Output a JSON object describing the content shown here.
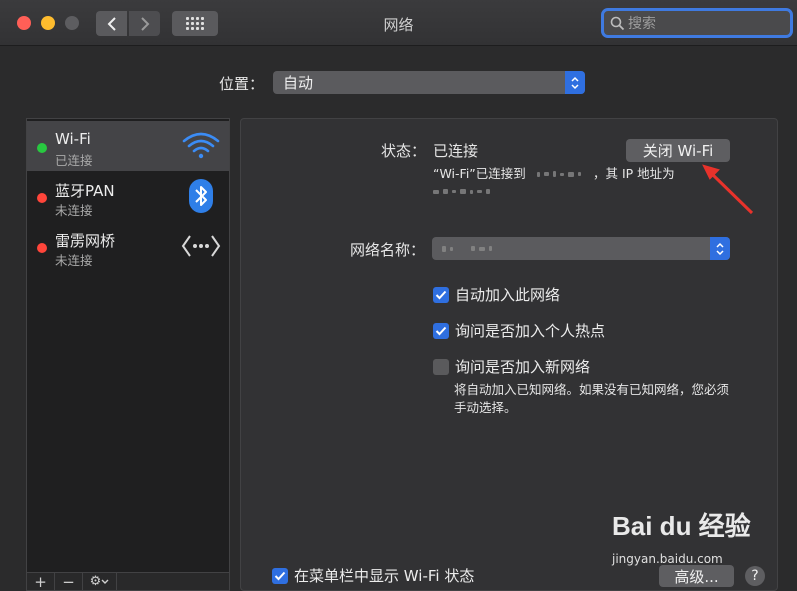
{
  "window": {
    "title": "网络",
    "search_placeholder": "搜索"
  },
  "location": {
    "label": "位置：",
    "value": "自动"
  },
  "sidebar": {
    "services": [
      {
        "name": "Wi-Fi",
        "status": "已连接",
        "dot_color": "#28c840",
        "icon": "wifi-icon"
      },
      {
        "name": "蓝牙PAN",
        "status": "未连接",
        "dot_color": "#ff453a",
        "icon": "bluetooth-icon"
      },
      {
        "name": "雷雳网桥",
        "status": "未连接",
        "dot_color": "#ff453a",
        "icon": "thunderbolt-bridge-icon"
      }
    ],
    "buttons": {
      "add": "+",
      "remove": "−",
      "gear": "⚙"
    }
  },
  "detail": {
    "status_label": "状态：",
    "status_value": "已连接",
    "turn_off_button": "关闭 Wi-Fi",
    "status_desc_1": "“Wi-Fi”已连接到",
    "status_desc_2": "，其 IP 地址为",
    "network_name_label": "网络名称：",
    "options": [
      {
        "label": "自动加入此网络",
        "checked": true
      },
      {
        "label": "询问是否加入个人热点",
        "checked": true
      },
      {
        "label": "询问是否加入新网络",
        "checked": false
      }
    ],
    "ask_note_1": "将自动加入已知网络。如果没有已知网络，您必须",
    "ask_note_2": "手动选择。",
    "menubar_option": {
      "label": "在菜单栏中显示 Wi-Fi 状态",
      "checked": true
    },
    "advanced_button": "高级...",
    "help_button": "?"
  },
  "watermark": {
    "brand": "Bai du 经验",
    "url": "jingyan.baidu.com"
  },
  "colors": {
    "accent": "#2f6fe0",
    "annotation_arrow": "#e8322b"
  }
}
